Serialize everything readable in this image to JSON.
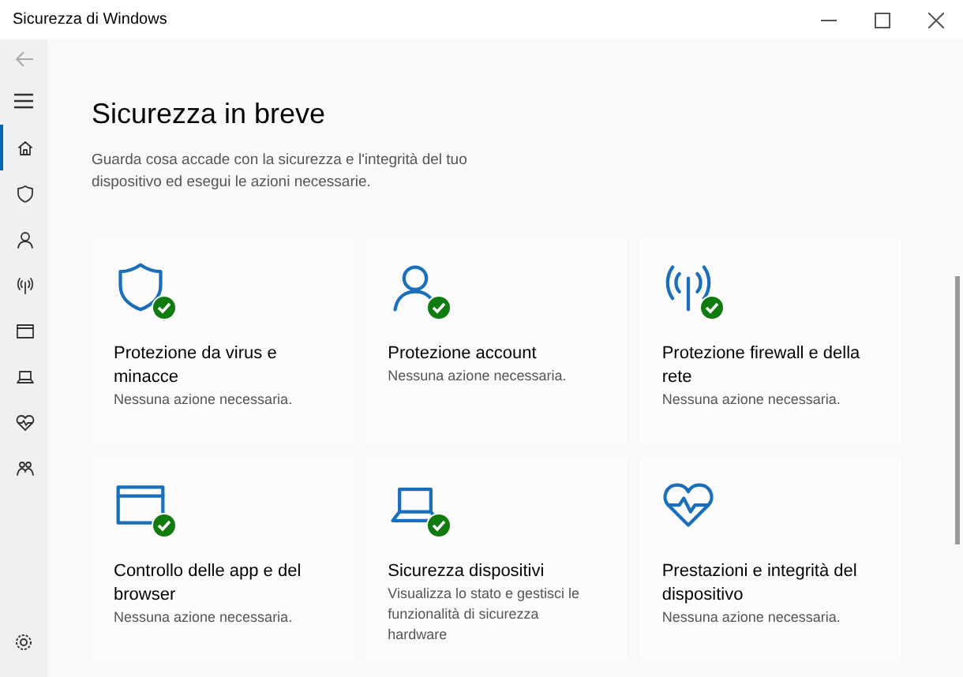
{
  "window": {
    "title": "Sicurezza di Windows"
  },
  "sidebar": {
    "items": [
      {
        "kind": "home",
        "selected": true
      },
      {
        "kind": "shield",
        "selected": false
      },
      {
        "kind": "person",
        "selected": false
      },
      {
        "kind": "antenna",
        "selected": false
      },
      {
        "kind": "browser",
        "selected": false
      },
      {
        "kind": "laptop",
        "selected": false
      },
      {
        "kind": "heart",
        "selected": false
      },
      {
        "kind": "family",
        "selected": false
      }
    ]
  },
  "page": {
    "title": "Sicurezza in breve",
    "description": "Guarda cosa accade con la sicurezza e l'integrità del tuo dispositivo ed esegui le azioni necessarie."
  },
  "tiles": [
    {
      "kind": "shield",
      "title": "Protezione da virus e minacce",
      "status": "Nessuna azione necessaria.",
      "ok": true
    },
    {
      "kind": "person",
      "title": "Protezione account",
      "status": "Nessuna azione necessaria.",
      "ok": true
    },
    {
      "kind": "antenna",
      "title": "Protezione firewall e della rete",
      "status": "Nessuna azione necessaria.",
      "ok": true
    },
    {
      "kind": "browser",
      "title": "Controllo delle app e del browser",
      "status": "Nessuna azione necessaria.",
      "ok": true
    },
    {
      "kind": "laptop",
      "title": "Sicurezza dispositivi",
      "status": "Visualizza lo stato e gestisci le funzionalità di sicurezza hardware",
      "ok": true
    },
    {
      "kind": "heart",
      "title": "Prestazioni e integrità del dispositivo",
      "status": "Nessuna azione necessaria.",
      "ok": false
    }
  ]
}
